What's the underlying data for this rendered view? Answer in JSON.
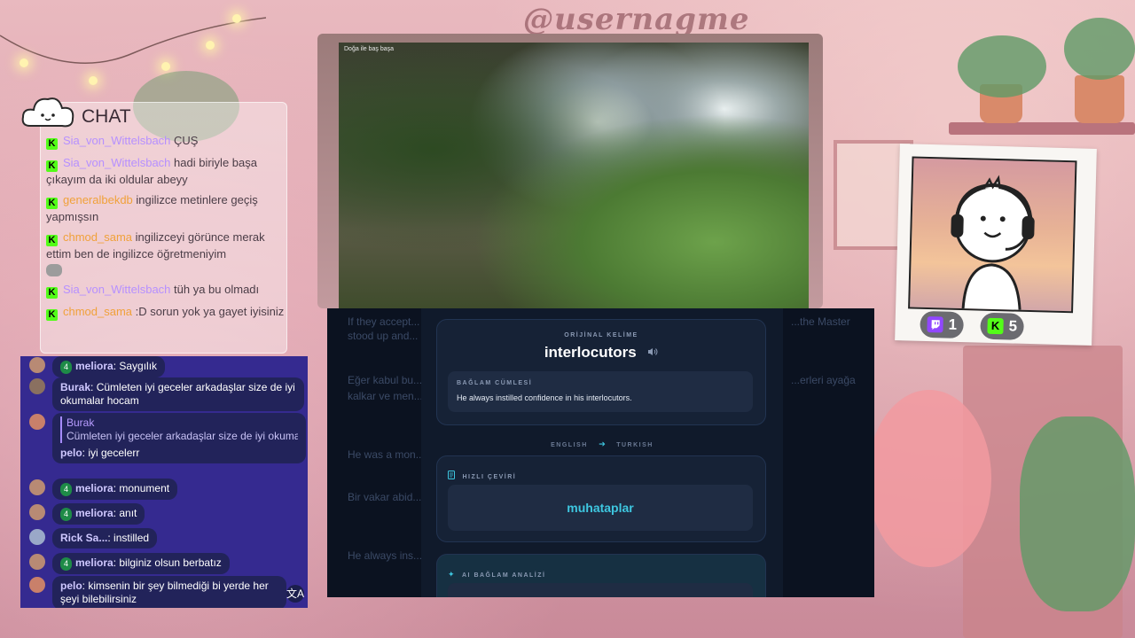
{
  "watermark": "@usernagme",
  "chat": {
    "title": "CHAT",
    "messages": [
      {
        "user": "Sia_von_Wittelsbach",
        "text": "ÇUŞ",
        "color": "purple"
      },
      {
        "user": "Sia_von_Wittelsbach",
        "text": "hadi biriyle başa çıkayım da iki oldular abeyy",
        "color": "purple"
      },
      {
        "user": "generalbekdb",
        "text": "ingilizce metinlere geçiş yapmışsın",
        "color": "orange"
      },
      {
        "user": "chmod_sama",
        "text": "ingilizceyi görünce merak ettim ben de ingilizce öğretmeniyim",
        "color": "orange"
      },
      {
        "user": "Sia_von_Wittelsbach",
        "text": "tüh ya bu olmadı",
        "color": "purple"
      },
      {
        "user": "chmod_sama",
        "text": ":D sorun yok ya gayet iyisiniz",
        "color": "orange"
      }
    ]
  },
  "twitch_chat": {
    "messages": [
      {
        "user": "meliora",
        "badge": "4",
        "text": "Saygılık"
      },
      {
        "user": "Burak",
        "text": "Cümleten iyi geceler arkadaşlar size de iyi okumalar hocam"
      },
      {
        "user": "pelo",
        "reply_to": "Burak",
        "reply_text": "Cümleten iyi geceler arkadaşlar size de iyi okumal...",
        "text": "iyi gecelerr"
      },
      {
        "user": "meliora",
        "badge": "4",
        "text": "monument"
      },
      {
        "user": "meliora",
        "badge": "4",
        "text": "anıt"
      },
      {
        "user": "Rick Sa...",
        "text": "instilled"
      },
      {
        "user": "meliora",
        "badge": "4",
        "text": "bilginiz olsun berbatız"
      },
      {
        "user": "pelo",
        "text": "kimsenin bir şey bilmediği bi yerde her şeyi bilebilirsiniz"
      }
    ],
    "translate_icon": "文A"
  },
  "video": {
    "caption": "Doğa ile baş başa"
  },
  "app": {
    "bg_lines": [
      "If they accept...",
      "stood up and...",
      "Eğer kabul bu...",
      "kalkar ve men...",
      "He was a mon...",
      "Bir vakar abid...",
      "He always ins...",
      "...the Master",
      "...erleri ayağa"
    ],
    "original_label": "ORİJİNAL KELİME",
    "word": "interlocutors",
    "sentence_label": "BAĞLAM CÜMLESİ",
    "sentence": "He always instilled confidence in his interlocutors.",
    "lang_from": "ENGLISH",
    "lang_to": "TURKISH",
    "quick_label": "HIZLI ÇEVİRİ",
    "translation": "muhataplar",
    "ai_label": "AI BAĞLAM ANALİZİ"
  },
  "cam": {
    "twitch_count": "1",
    "kick_count": "5"
  }
}
